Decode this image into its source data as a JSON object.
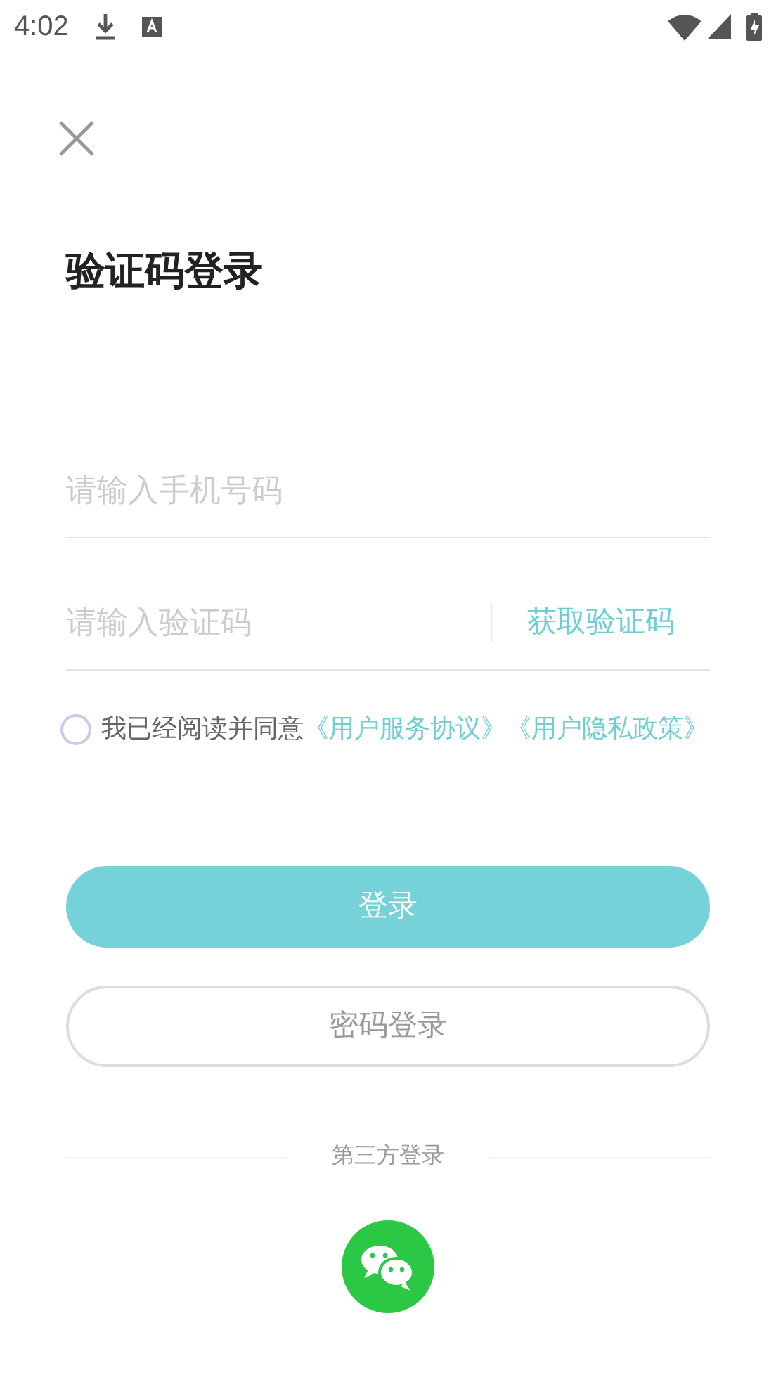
{
  "status_bar": {
    "time": "4:02"
  },
  "title": "验证码登录",
  "phone_field": {
    "placeholder": "请输入手机号码"
  },
  "code_field": {
    "placeholder": "请输入验证码"
  },
  "get_code_link": "获取验证码",
  "agreement": {
    "checked": false,
    "text": "我已经阅读并同意",
    "links": [
      "《用户服务协议》",
      "《用户隐私政策》"
    ]
  },
  "buttons": [
    {
      "kind": "primary",
      "label": "登录"
    },
    {
      "kind": "outline",
      "label": "密码登录"
    }
  ],
  "third_party": {
    "label": "第三方登录"
  }
}
